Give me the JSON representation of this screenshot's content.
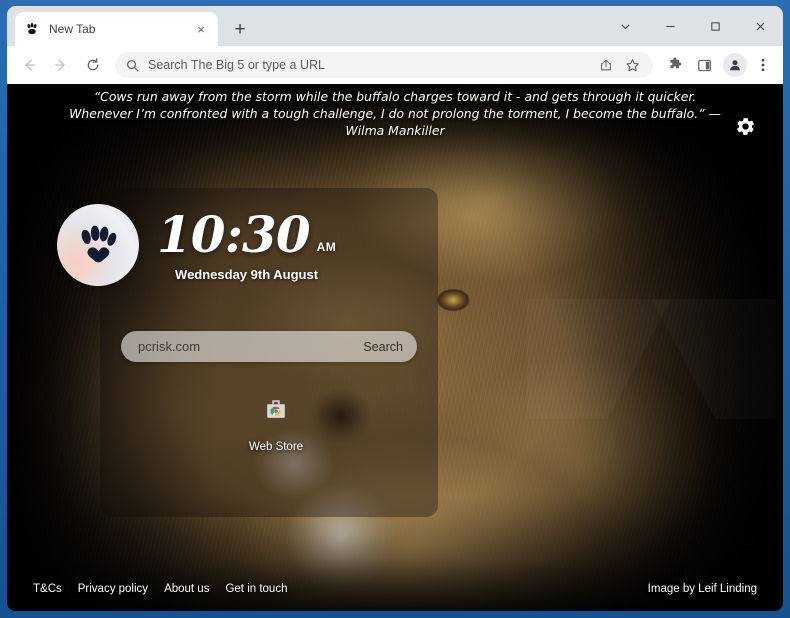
{
  "browser": {
    "tab": {
      "title": "New Tab",
      "favicon": "paw-print-icon",
      "close_label": "×"
    },
    "new_tab_label": "+",
    "window_controls": {
      "tab_search_icon": "chevron-down-icon",
      "minimize_icon": "minimize-icon",
      "maximize_icon": "maximize-icon",
      "close_icon": "close-icon"
    },
    "toolbar": {
      "back_icon": "back-arrow-icon",
      "forward_icon": "forward-arrow-icon",
      "reload_icon": "reload-icon",
      "omnibox": {
        "search_icon": "search-icon",
        "placeholder": "Search The Big 5 or type a URL",
        "value": "",
        "share_icon": "share-icon",
        "bookmark_icon": "star-icon"
      },
      "extensions_icon": "puzzle-piece-icon",
      "side_panel_icon": "side-panel-icon",
      "profile_icon": "profile-avatar-icon",
      "menu_icon": "three-dot-menu-icon"
    }
  },
  "page": {
    "quote": "“Cows run away from the storm while the buffalo charges toward it - and gets through it quicker. Whenever I’m confronted with a tough challenge, I do not prolong the torment, I become the buffalo.” —Wilma Mankiller",
    "settings_icon": "gear-icon",
    "logo_icon": "paw-print-logo-icon",
    "clock": {
      "time": "10:30",
      "meridiem": "AM",
      "date": "Wednesday 9th August"
    },
    "search": {
      "value": "pcrisk.com",
      "placeholder": "pcrisk.com",
      "submit_label": "Search"
    },
    "shortcuts": [
      {
        "label": "Web Store",
        "icon": "chrome-web-store-icon"
      }
    ],
    "footer": {
      "links": [
        {
          "label": "T&Cs"
        },
        {
          "label": "Privacy policy"
        },
        {
          "label": "About us"
        },
        {
          "label": "Get in touch"
        }
      ],
      "credit": "Image by Leif Linding"
    }
  },
  "colors": {
    "window_frame": "#1f5fa8",
    "tabstrip": "#dee1e6",
    "toolbar": "#ffffff",
    "omnibox": "#f1f3f4",
    "page_background": "#000000",
    "accent_text": "#ffffff",
    "paw_dark": "#131c2e"
  }
}
